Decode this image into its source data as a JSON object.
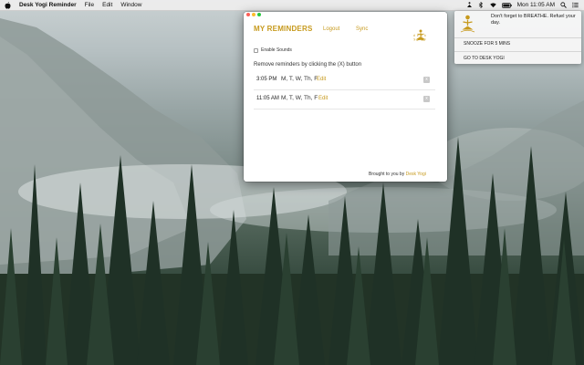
{
  "menubar": {
    "app_name": "Desk Yogi Reminder",
    "items": [
      "File",
      "Edit",
      "Window"
    ],
    "clock": "Mon 11:05 AM"
  },
  "window": {
    "title": "MY REMINDERS",
    "logout": "Logout",
    "sync": "Sync",
    "logo_text": "desk yogi",
    "enable_sounds": "Enable Sounds",
    "instruction": "Remove reminders by clicking the (X) button",
    "reminders": [
      {
        "time": "3:05 PM",
        "days": "M, T, W, Th, F",
        "edit": "Edit",
        "remove": "x"
      },
      {
        "time": "11:05 AM",
        "days": "M, T, W, Th, F",
        "edit": "Edit",
        "remove": "x"
      }
    ],
    "credit_prefix": "Brought to you by",
    "credit_link": "Desk Yogi"
  },
  "notification": {
    "message": "Don't forget to BREATHE. Refuel your day.",
    "snooze": "SNOOZE FOR 5 MINS",
    "goto": "GO TO DESK YOGI"
  },
  "colors": {
    "brand": "#c79a1d",
    "remove_button": "#c8c8c8"
  },
  "icons": [
    "apple-icon",
    "bluetooth-icon",
    "wifi-icon",
    "battery-icon",
    "search-icon",
    "notification-center-icon",
    "desk-yogi-logo-icon"
  ]
}
